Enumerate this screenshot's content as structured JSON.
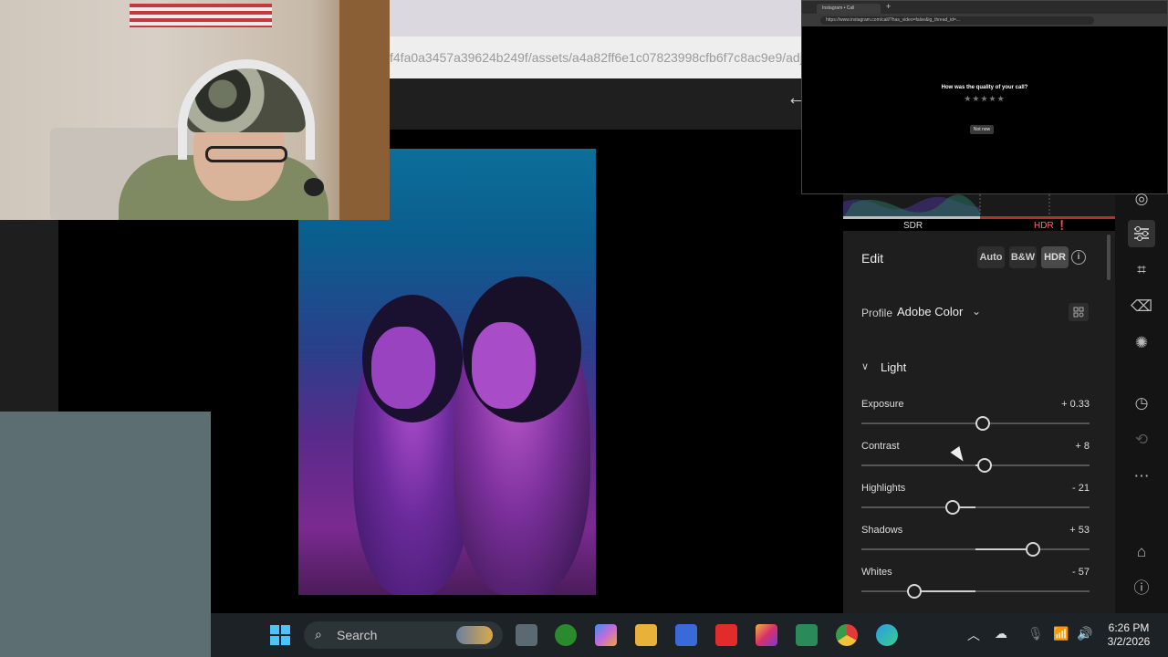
{
  "browser": {
    "url_fragment": "f4fa0a3457a39624b249f/assets/a4a82ff6e1c07823998cfb6f7c8ac9e9/adju"
  },
  "popup": {
    "tab_title": "Instagram • Call",
    "url": "https://www.instagram.com/call/?has_video=false&ig_thread_id=...",
    "question": "How was the quality of your call?",
    "stars": "★★★★★",
    "not_now": "Not now"
  },
  "histogram": {
    "sdr_label": "SDR",
    "hdr_label": "HDR"
  },
  "edit_panel": {
    "title": "Edit",
    "buttons": {
      "auto": "Auto",
      "bw": "B&W",
      "hdr": "HDR",
      "info": "i"
    },
    "profile_label": "Profile",
    "profile_value": "Adobe Color",
    "section_light": "Light",
    "sliders": [
      {
        "label": "Exposure",
        "value": "+ 0.33",
        "level": 0.53
      },
      {
        "label": "Contrast",
        "value": "+ 8",
        "level": 0.54
      },
      {
        "label": "Highlights",
        "value": "- 21",
        "level": 0.4
      },
      {
        "label": "Shadows",
        "value": "+ 53",
        "level": 0.75
      },
      {
        "label": "Whites",
        "value": "- 57",
        "level": 0.23
      }
    ]
  },
  "toolbar": {
    "icons": [
      "mask-icon",
      "edit-sliders-icon",
      "crop-icon",
      "eraser-icon",
      "filter-icon",
      "history-icon",
      "versions-icon",
      "more-icon",
      "tag-icon",
      "info-icon"
    ]
  },
  "taskbar": {
    "search_label": "Search",
    "time": "6:26 PM",
    "date": "3/2/2026"
  }
}
